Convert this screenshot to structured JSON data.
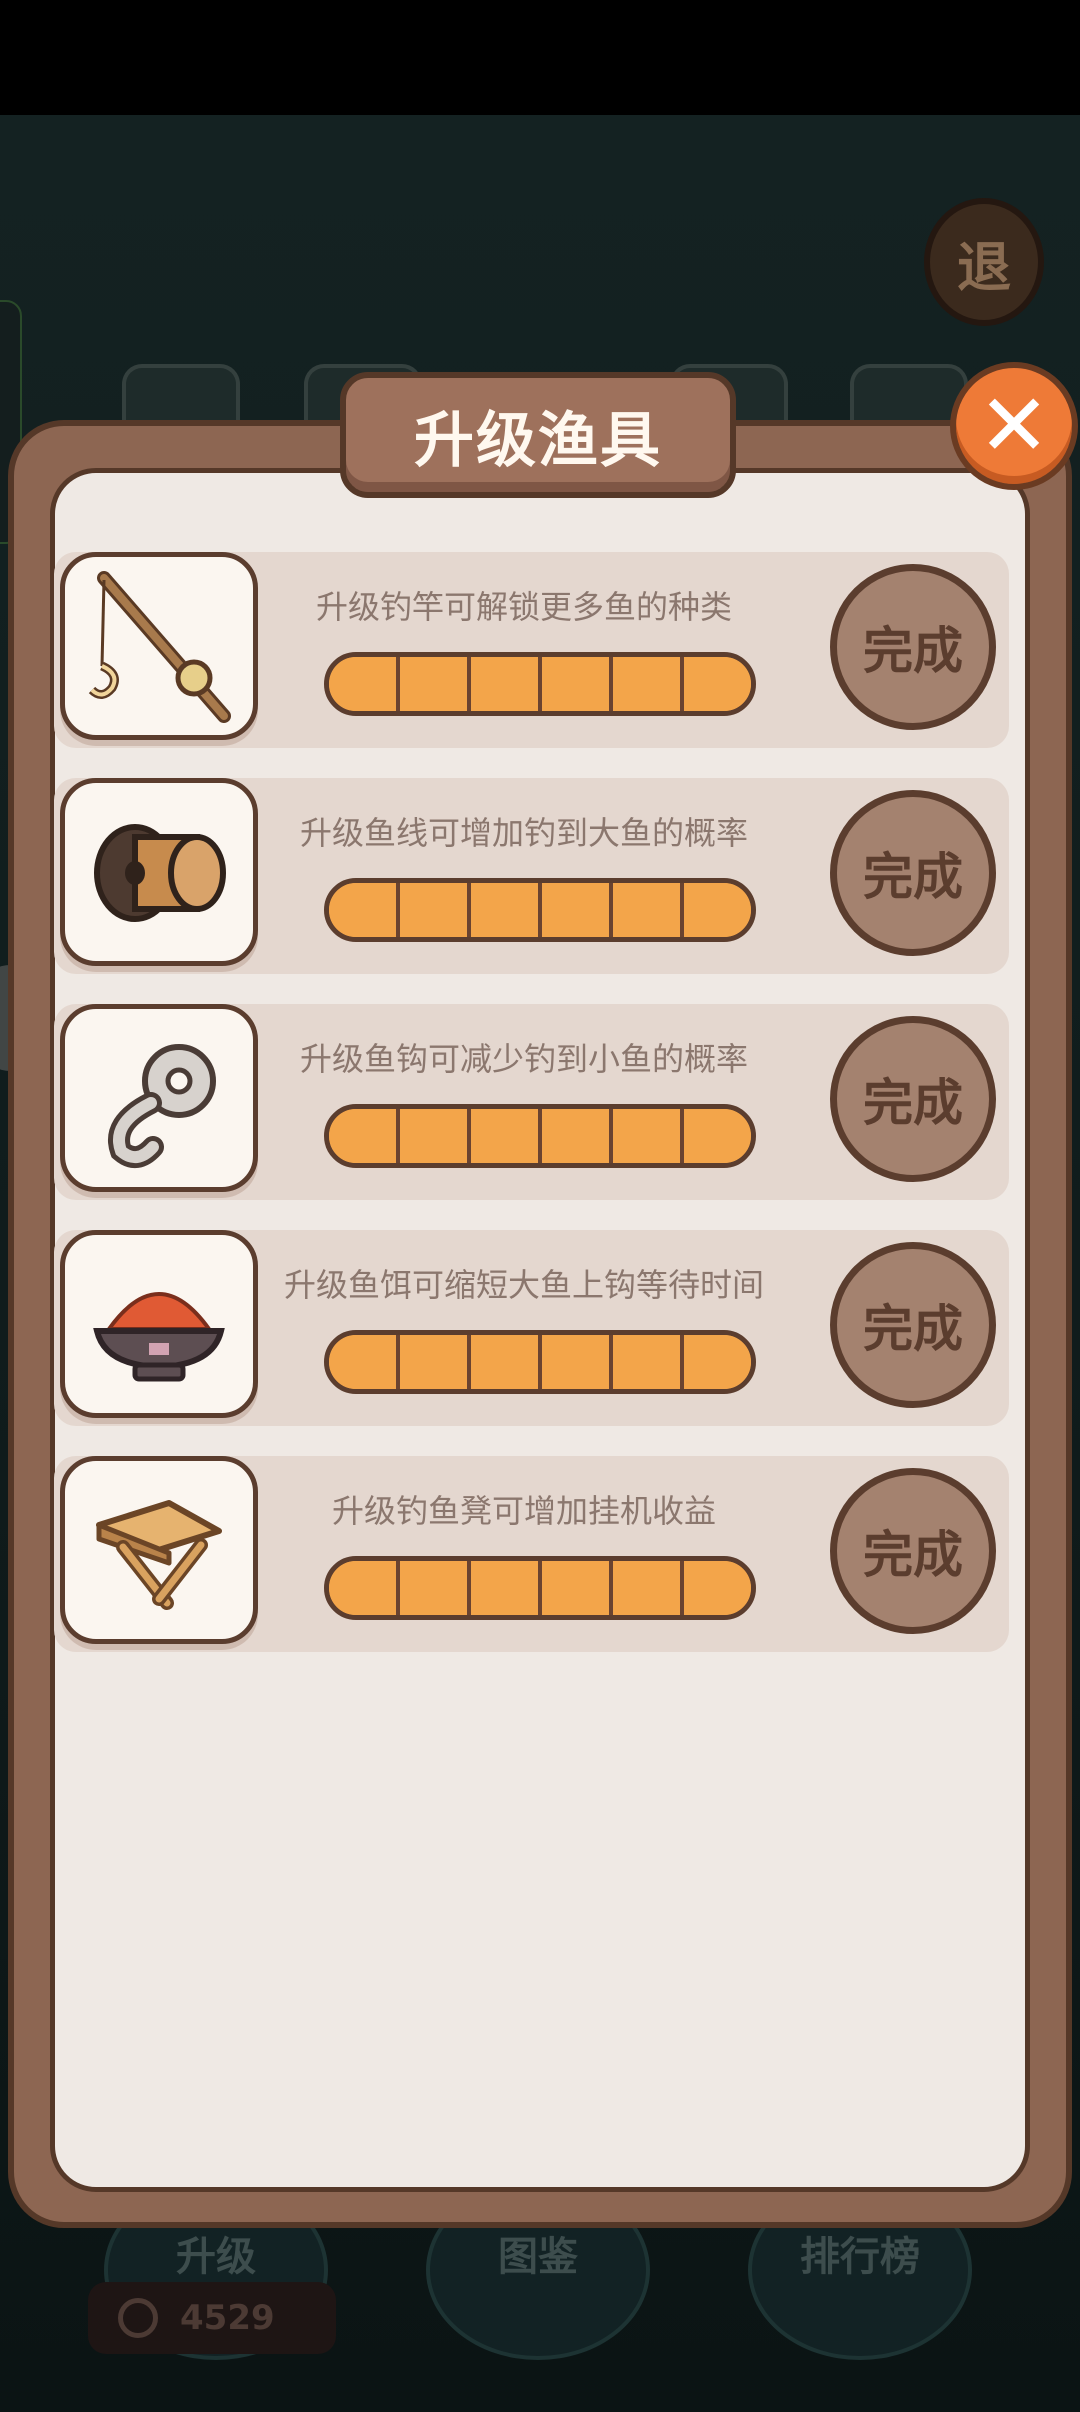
{
  "background": {
    "exit_label": "退",
    "bottom_nav": [
      {
        "label": "升级"
      },
      {
        "label": "图鉴"
      },
      {
        "label": "排行榜"
      }
    ],
    "coins": "4529"
  },
  "dialog": {
    "title": "升级渔具",
    "close_icon": "close-x",
    "items": [
      {
        "icon": "fishing-rod-icon",
        "description": "升级钓竿可解锁更多鱼的种类",
        "progress": 1.0,
        "segments": 6,
        "button": "完成"
      },
      {
        "icon": "fishing-reel-icon",
        "description": "升级鱼线可增加钓到大鱼的概率",
        "progress": 1.0,
        "segments": 6,
        "button": "完成"
      },
      {
        "icon": "fishing-hook-icon",
        "description": "升级鱼钩可减少钓到小鱼的概率",
        "progress": 1.0,
        "segments": 6,
        "button": "完成"
      },
      {
        "icon": "bait-bowl-icon",
        "description": "升级鱼饵可缩短大鱼上钩等待时间",
        "progress": 1.0,
        "segments": 6,
        "button": "完成"
      },
      {
        "icon": "fishing-stool-icon",
        "description": "升级钓鱼凳可增加挂机收益",
        "progress": 1.0,
        "segments": 6,
        "button": "完成"
      }
    ]
  },
  "colors": {
    "panel_border": "#553828",
    "panel_fill": "#efe9e4",
    "progress_orange": "#f3a54a",
    "close_orange": "#ee7a37",
    "done_button": "#a4826f"
  }
}
